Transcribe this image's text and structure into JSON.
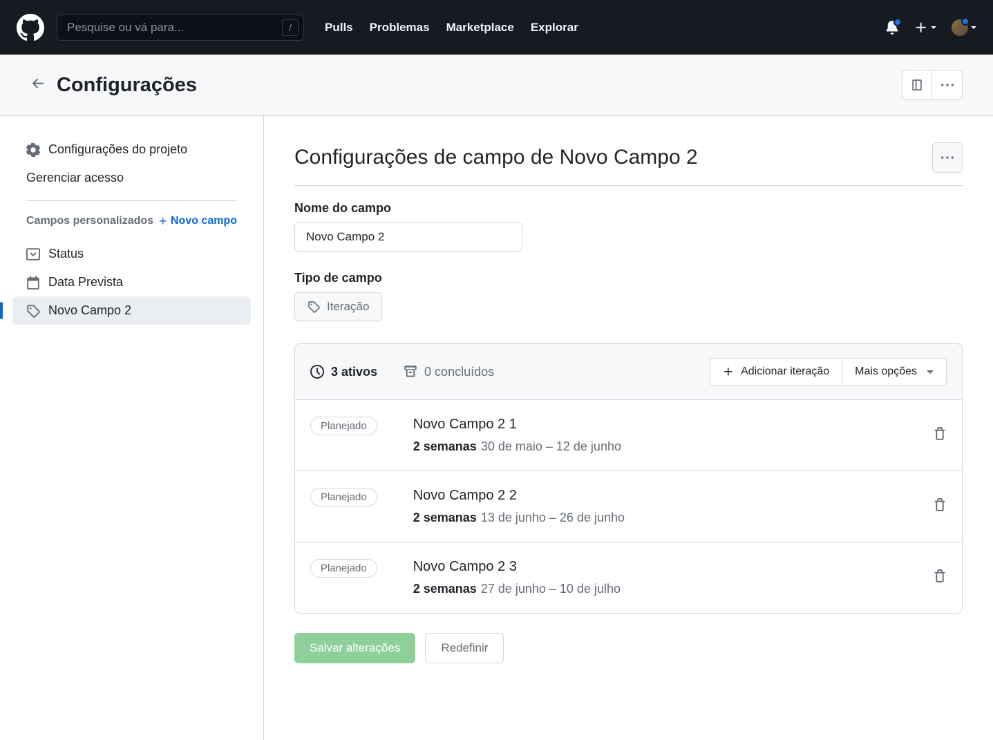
{
  "topbar": {
    "search_placeholder": "Pesquise ou vá para...",
    "search_key": "/",
    "nav": [
      "Pulls",
      "Problemas",
      "Marketplace",
      "Explorar"
    ]
  },
  "subheader": {
    "title": "Configurações"
  },
  "sidebar": {
    "project_settings": "Configurações do projeto",
    "manage_access": "Gerenciar acesso",
    "custom_fields_title": "Campos personalizados",
    "new_field": "Novo campo",
    "fields": [
      {
        "label": "Status",
        "icon": "single-select"
      },
      {
        "label": "Data Prevista",
        "icon": "calendar"
      },
      {
        "label": "Novo Campo 2",
        "icon": "iteration",
        "active": true
      }
    ]
  },
  "main": {
    "title": "Configurações de campo de Novo Campo 2",
    "field_name_label": "Nome do campo",
    "field_name_value": "Novo Campo 2",
    "field_type_label": "Tipo de campo",
    "field_type_value": "Iteração",
    "active_count": "3 ativos",
    "completed_count": "0 concluídos",
    "add_iteration": "Adicionar iteração",
    "more_options": "Mais opções",
    "iterations": [
      {
        "badge": "Planejado",
        "name": "Novo Campo 2 1",
        "duration": "2 semanas",
        "range": "30 de maio – 12 de junho"
      },
      {
        "badge": "Planejado",
        "name": "Novo Campo 2 2",
        "duration": "2 semanas",
        "range": "13 de junho – 26 de junho"
      },
      {
        "badge": "Planejado",
        "name": "Novo Campo 2 3",
        "duration": "2 semanas",
        "range": "27 de junho – 10 de julho"
      }
    ],
    "save": "Salvar alterações",
    "reset": "Redefinir"
  }
}
